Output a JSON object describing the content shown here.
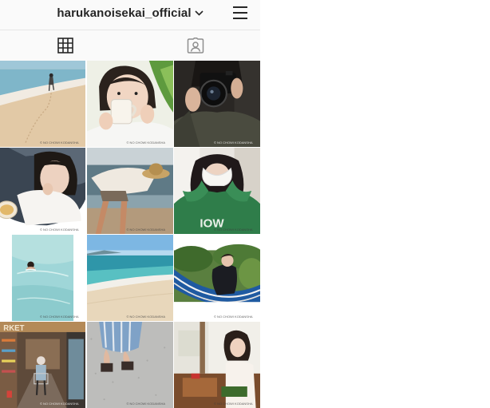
{
  "header": {
    "username": "harukanoisekai_official",
    "dropdown_icon": "chevron-down-icon",
    "menu_icon": "hamburger-menu-icon"
  },
  "tabs": [
    {
      "name": "posts-grid",
      "icon": "grid-icon",
      "active": true
    },
    {
      "name": "tagged",
      "icon": "tagged-person-icon",
      "active": false
    }
  ],
  "watermark": "© NO CHOWI KODANSHA",
  "posts": [
    {
      "alt": "beach-walk"
    },
    {
      "alt": "woman-drinking-mug"
    },
    {
      "alt": "woman-with-camera"
    },
    {
      "alt": "woman-eating"
    },
    {
      "alt": "woman-straw-hat-beach"
    },
    {
      "alt": "woman-cup-green-hoodie"
    },
    {
      "alt": "swimming-in-sea"
    },
    {
      "alt": "beach-shoreline"
    },
    {
      "alt": "woman-in-hammock"
    },
    {
      "alt": "market-aisle"
    },
    {
      "alt": "feet-sandals"
    },
    {
      "alt": "woman-in-kitchen"
    }
  ]
}
